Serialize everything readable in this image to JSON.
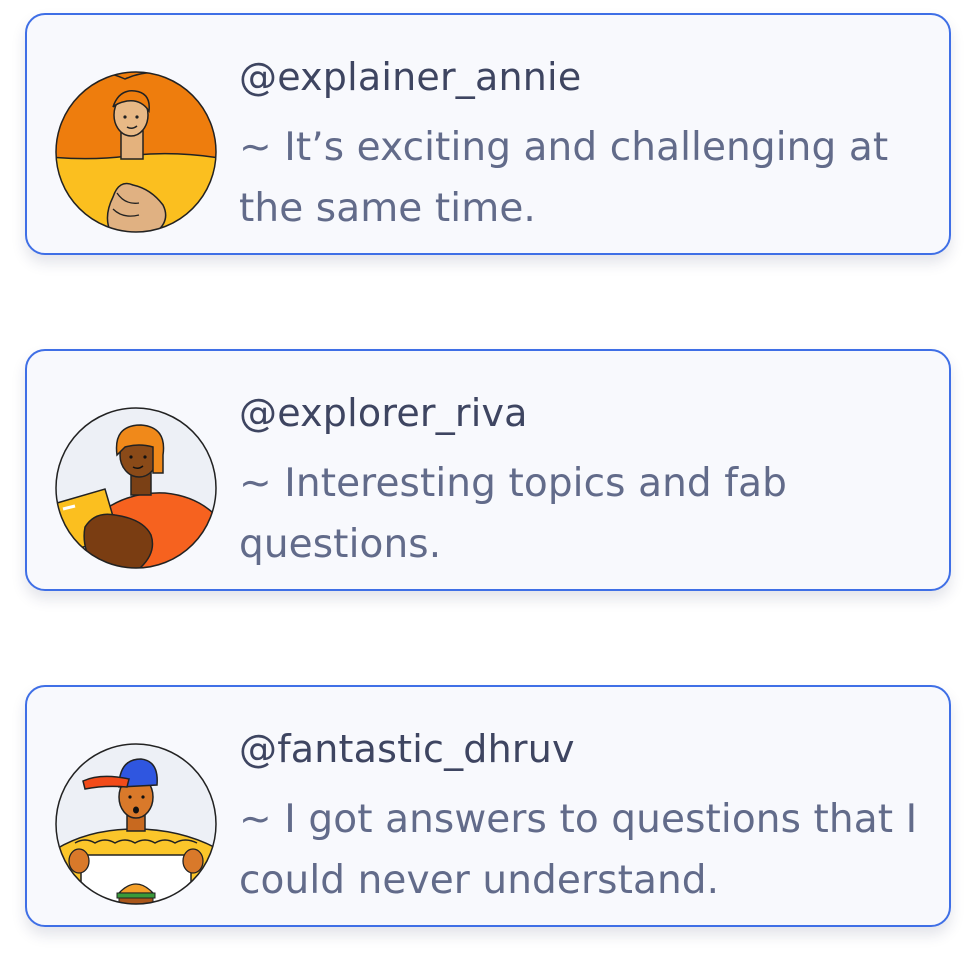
{
  "testimonials": [
    {
      "handle": "@explainer_annie",
      "quote": "~ It’s exciting and challenging at the same time.",
      "avatar_icon": "woman-orange-hair-avatar-icon"
    },
    {
      "handle": "@explorer_riva",
      "quote": "~ Interesting topics and fab questions.",
      "avatar_icon": "girl-with-book-avatar-icon"
    },
    {
      "handle": "@fantastic_dhruv",
      "quote": "~ I got answers to questions that I could never understand.",
      "avatar_icon": "boy-blue-cap-avatar-icon"
    }
  ],
  "colors": {
    "card_border": "#3f6fe6",
    "card_background": "#f8f9fd",
    "handle_text": "#3e4561",
    "quote_text": "#626b8a"
  }
}
